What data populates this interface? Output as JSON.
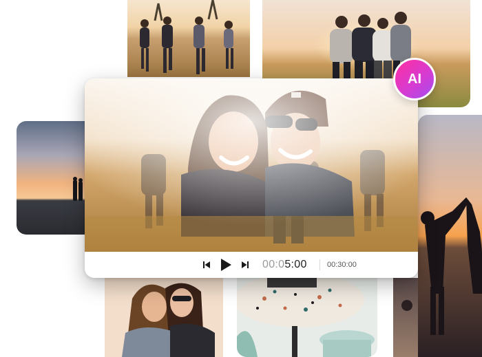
{
  "badge": {
    "label": "AI"
  },
  "player": {
    "time_current_dim": "00:0",
    "time_current_main": "5:00",
    "time_total": "00:30:00",
    "icons": {
      "prev": "skip-back-icon",
      "play": "play-icon",
      "next": "skip-forward-icon"
    }
  },
  "colors": {
    "badge_gradient_start": "#ff2fa0",
    "badge_gradient_end": "#a44df0",
    "sunset_sky": "#f3c38a",
    "desert_ground": "#b58a4a"
  }
}
